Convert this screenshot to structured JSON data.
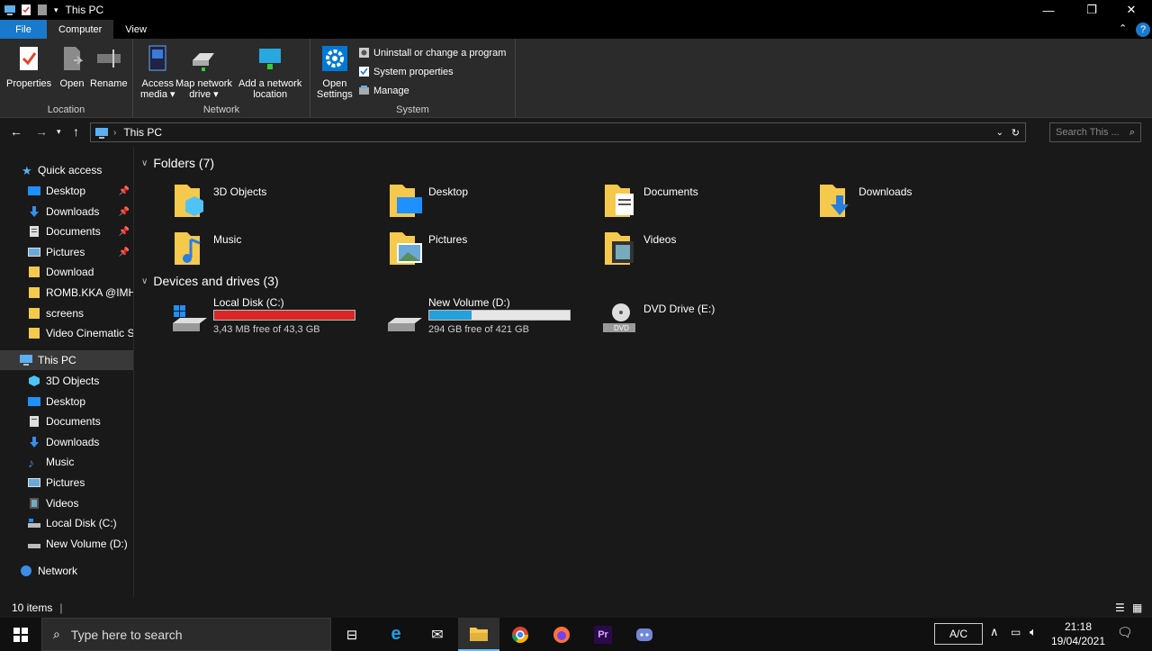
{
  "window": {
    "title": "This PC"
  },
  "ribbon_tabs": [
    "File",
    "Computer",
    "View"
  ],
  "ribbon": {
    "location": {
      "label": "Location",
      "properties": "Properties",
      "open": "Open",
      "rename": "Rename"
    },
    "network": {
      "label": "Network",
      "access_media": "Access",
      "access_media_2": "media",
      "map_drive": "Map network",
      "map_drive_2": "drive",
      "add_location": "Add a network",
      "add_location_2": "location"
    },
    "system": {
      "label": "System",
      "open_settings": "Open",
      "open_settings_2": "Settings",
      "uninstall": "Uninstall or change a program",
      "system_properties": "System properties",
      "manage": "Manage"
    }
  },
  "address": {
    "path": "This PC",
    "search_placeholder": "Search This ..."
  },
  "sidebar": {
    "quick_access": "Quick access",
    "quick_items": [
      "Desktop",
      "Downloads",
      "Documents",
      "Pictures",
      "Download",
      "ROMB.KKA @IMHZ",
      "screens",
      "Video Cinematic Se"
    ],
    "this_pc": "This PC",
    "pc_items": [
      "3D Objects",
      "Desktop",
      "Documents",
      "Downloads",
      "Music",
      "Pictures",
      "Videos",
      "Local Disk (C:)",
      "New Volume (D:)"
    ],
    "network": "Network"
  },
  "content": {
    "folders_header": "Folders (7)",
    "folders": [
      "3D Objects",
      "Desktop",
      "Documents",
      "Downloads",
      "Music",
      "Pictures",
      "Videos"
    ],
    "drives_header": "Devices and drives (3)",
    "drives": [
      {
        "name": "Local Disk (C:)",
        "free": "3,43 MB free of 43,3 GB",
        "used_fraction": 0.9999,
        "bar_color": "#da2626"
      },
      {
        "name": "New Volume (D:)",
        "free": "294 GB free of 421 GB",
        "used_fraction": 0.302,
        "bar_color": "#26a0da"
      },
      {
        "name": "DVD Drive (E:)"
      }
    ]
  },
  "status": {
    "items": "10 items"
  },
  "taskbar": {
    "search_placeholder": "Type here to search",
    "tray_label": "A/C",
    "time": "21:18",
    "date": "19/04/2021"
  },
  "colors": {
    "accent": "#1979ca",
    "folder": "#f5c94c",
    "selected": "#393939"
  }
}
